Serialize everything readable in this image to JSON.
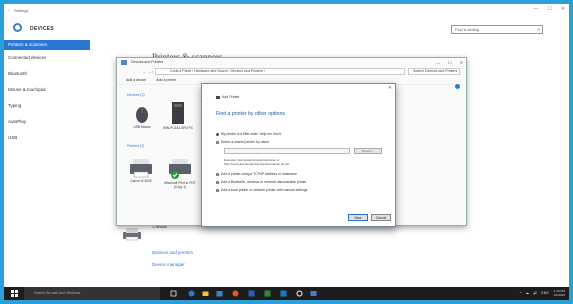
{
  "settings": {
    "window_title": "Settings",
    "back_glyph": "←",
    "window_controls": [
      "—",
      "☐",
      "✕"
    ],
    "heading": "DEVICES",
    "search_placeholder": "Find a setting",
    "sidebar": [
      {
        "label": "Printers & scanners",
        "active": true
      },
      {
        "label": "Connected devices",
        "active": false
      },
      {
        "label": "Bluetooth",
        "active": false
      },
      {
        "label": "Mouse & touchpad",
        "active": false
      },
      {
        "label": "Typing",
        "active": false
      },
      {
        "label": "AutoPlay",
        "active": false
      },
      {
        "label": "USB",
        "active": false
      }
    ],
    "page_title": "Printers & scanners",
    "bottom_device_label": "1 device",
    "links": [
      "Devices and printers",
      "Device manager"
    ]
  },
  "control_panel": {
    "title": "Devices and Printers",
    "address": "Control Panel  ›  Hardware and Sound  ›  Devices and Printers  ›",
    "search_placeholder": "Search Devices and Printers",
    "commands": [
      "Add a device",
      "Add a printer"
    ],
    "sections": {
      "devices": "Devices (2)",
      "printers": "Printers (2)"
    },
    "devices": [
      {
        "label": "USB Mouse"
      },
      {
        "label": "WIN-PC3A1-SRV-PC"
      }
    ],
    "printers": [
      {
        "label": "Canon IX 4000"
      },
      {
        "label": "Microsoft Print to PDF (Copy 1)"
      }
    ]
  },
  "dialog": {
    "close_glyph": "✕",
    "back_glyph": "←",
    "title": "Add Printer",
    "heading": "Find a printer by other options",
    "options": [
      {
        "label": "My printer is a little older. Help me find it.",
        "selected": true
      },
      {
        "label": "Select a shared printer by name",
        "selected": false
      },
      {
        "label": "Add a printer using a TCP/IP address or hostname",
        "selected": false
      },
      {
        "label": "Add a Bluetooth, wireless or network discoverable printer",
        "selected": false
      },
      {
        "label": "Add a local printer or network printer with manual settings",
        "selected": false
      }
    ],
    "browse_label": "Browse...",
    "example_line1": "Example: \\\\computername\\printername or",
    "example_line2": "http://computername/printers/printername/.printer",
    "next_label": "Next",
    "cancel_label": "Cancel"
  },
  "taskbar": {
    "search_placeholder": "Search the web and Windows",
    "tray_glyphs": [
      "^",
      "☁",
      "🔊",
      "ENG"
    ],
    "clock_time": "1:15 PM",
    "clock_date": "1/1/2016"
  },
  "colors": {
    "desktop": "#2b9fd8",
    "accent": "#2b78d4",
    "taskbar": "#1d1d1d"
  }
}
